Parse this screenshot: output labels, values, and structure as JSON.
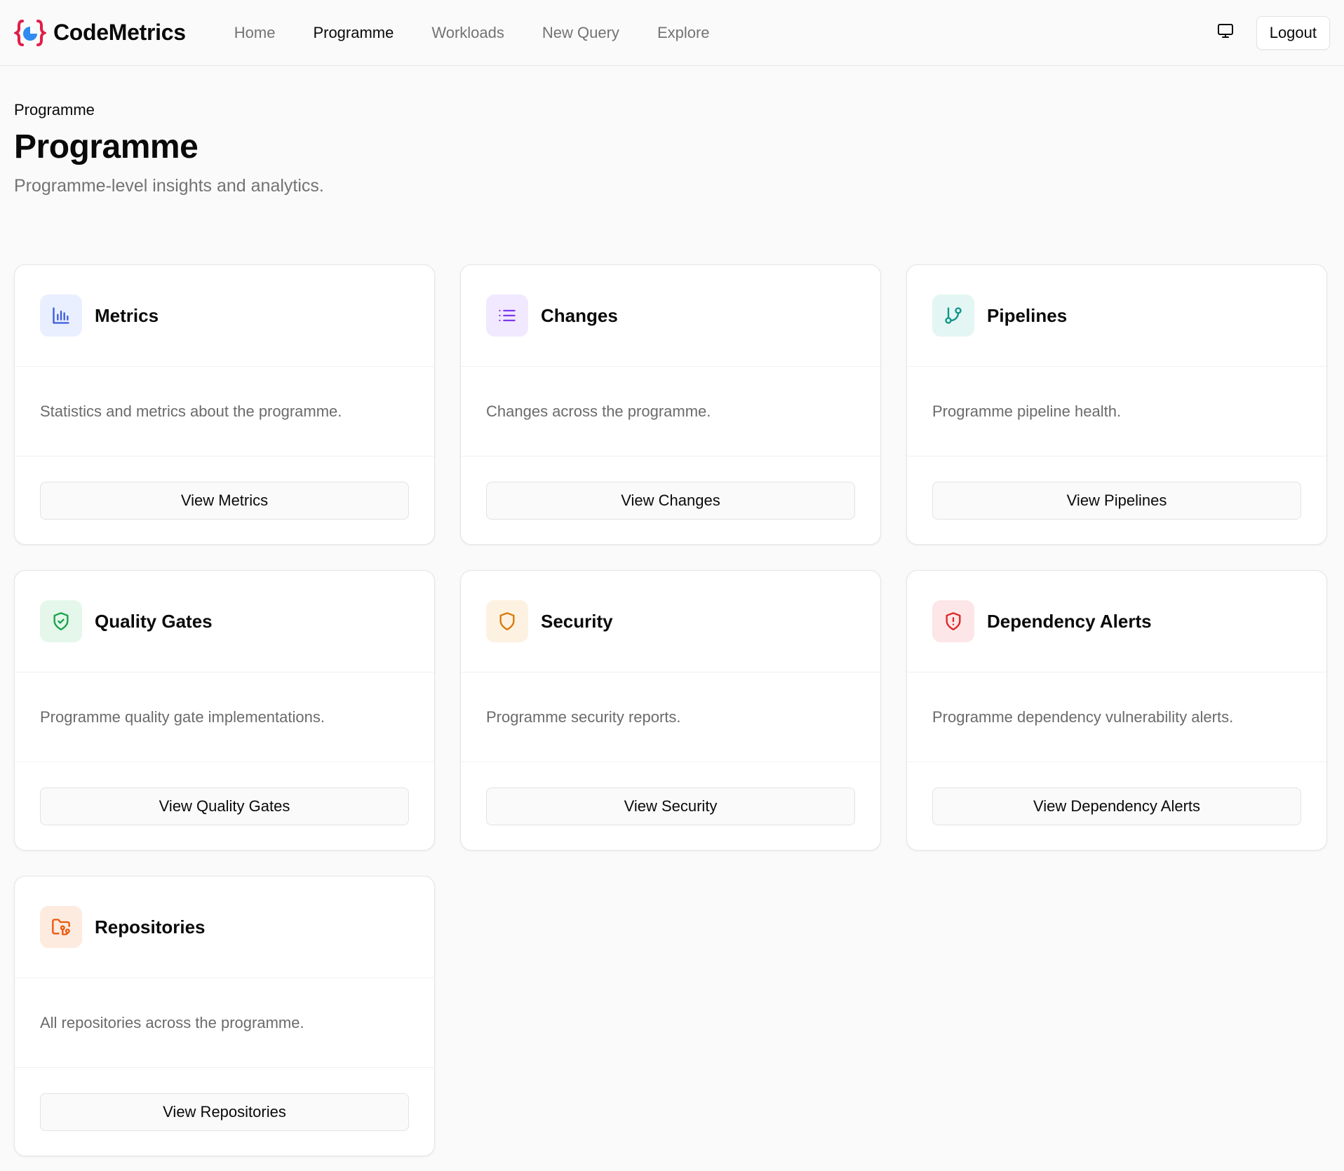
{
  "brand": {
    "name": "CodeMetrics",
    "logo_icon": "braces-logo-icon",
    "colors": {
      "braces": "#e11d48",
      "circle": "#2e8cf0"
    }
  },
  "nav": {
    "items": [
      {
        "label": "Home",
        "active": false
      },
      {
        "label": "Programme",
        "active": true
      },
      {
        "label": "Workloads",
        "active": false
      },
      {
        "label": "New Query",
        "active": false
      },
      {
        "label": "Explore",
        "active": false
      }
    ],
    "monitor_icon": "monitor-icon",
    "logout_label": "Logout"
  },
  "header": {
    "breadcrumb": "Programme",
    "title": "Programme",
    "subtitle": "Programme-level insights and analytics."
  },
  "cards": [
    {
      "title": "Metrics",
      "description": "Statistics and metrics about the programme.",
      "button": "View Metrics",
      "icon": "bar-chart-icon",
      "icon_color": "#3b5bdb",
      "icon_bg": "#e9efff"
    },
    {
      "title": "Changes",
      "description": "Changes across the programme.",
      "button": "View Changes",
      "icon": "list-icon",
      "icon_color": "#7c3aed",
      "icon_bg": "#f1e9ff"
    },
    {
      "title": "Pipelines",
      "description": "Programme pipeline health.",
      "button": "View Pipelines",
      "icon": "git-branch-icon",
      "icon_color": "#0d9488",
      "icon_bg": "#e3f6f3"
    },
    {
      "title": "Quality Gates",
      "description": "Programme quality gate implementations.",
      "button": "View Quality Gates",
      "icon": "shield-check-icon",
      "icon_color": "#16a34a",
      "icon_bg": "#e4f7ea"
    },
    {
      "title": "Security",
      "description": "Programme security reports.",
      "button": "View Security",
      "icon": "shield-icon",
      "icon_color": "#d97706",
      "icon_bg": "#fdf2e2"
    },
    {
      "title": "Dependency Alerts",
      "description": "Programme dependency vulnerability alerts.",
      "button": "View Dependency Alerts",
      "icon": "shield-alert-icon",
      "icon_color": "#dc2626",
      "icon_bg": "#fde6e8"
    },
    {
      "title": "Repositories",
      "description": "All repositories across the programme.",
      "button": "View Repositories",
      "icon": "folder-git-icon",
      "icon_color": "#ea580c",
      "icon_bg": "#fdebe0"
    }
  ]
}
